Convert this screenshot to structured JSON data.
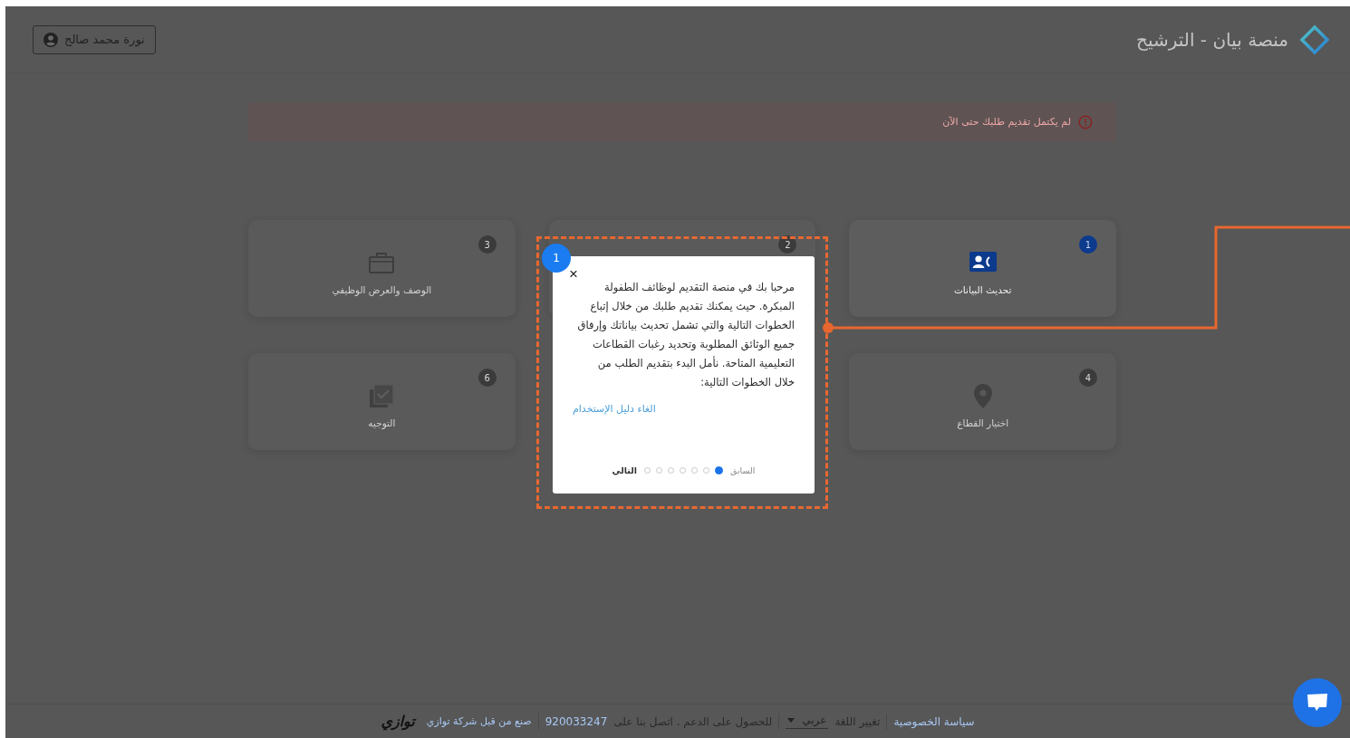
{
  "header": {
    "title": "منصة بيان - الترشيح",
    "user": "نورة محمد صالح"
  },
  "alert": {
    "text": "لم يكتمل تقديم طلبك حتى الآن"
  },
  "cards": [
    {
      "number": "1",
      "label": "تحديث البيانات",
      "active": true
    },
    {
      "number": "2",
      "active": false
    },
    {
      "number": "3",
      "label": "الوصف والعرض الوظيفي",
      "active": false
    },
    {
      "number": "4",
      "label": "اختيار القطاع",
      "active": false
    },
    {
      "number": "6",
      "label": "التوجيه",
      "active": false
    }
  ],
  "tour": {
    "step": "1",
    "close": "×",
    "text": "مرحبا بك في منصة التقديم لوظائف الطفولة المبكرة. حيث يمكنك تقديم طلبك من خلال إتباع الخطوات التالية والتي تشمل تحديث بياناتك وإرفاق جميع الوثائق المطلوبة وتحديد رغبات القطاعات التعليمية المتاحة. نأمل البدء بتقديم الطلب من خلال الخطوات التالية:",
    "skip": "الغاء دليل الإستخدام",
    "prev": {
      "label": "السابق",
      "disabled": true
    },
    "next": {
      "label": "التالي",
      "disabled": false
    },
    "dots": [
      {
        "selected": true
      },
      {
        "selected": false
      },
      {
        "selected": false
      },
      {
        "selected": false
      },
      {
        "selected": false
      },
      {
        "selected": false
      },
      {
        "selected": false
      }
    ]
  },
  "footer": {
    "privacy": "سياسة الخصوصية",
    "language_label": "تغيير اللغة",
    "language": "عربي",
    "support": "للحصول على الدعم . اتصل بنا على",
    "phone": "920033247",
    "made_by": "صنع من قبل شركة توازي",
    "logo": "توازي"
  }
}
